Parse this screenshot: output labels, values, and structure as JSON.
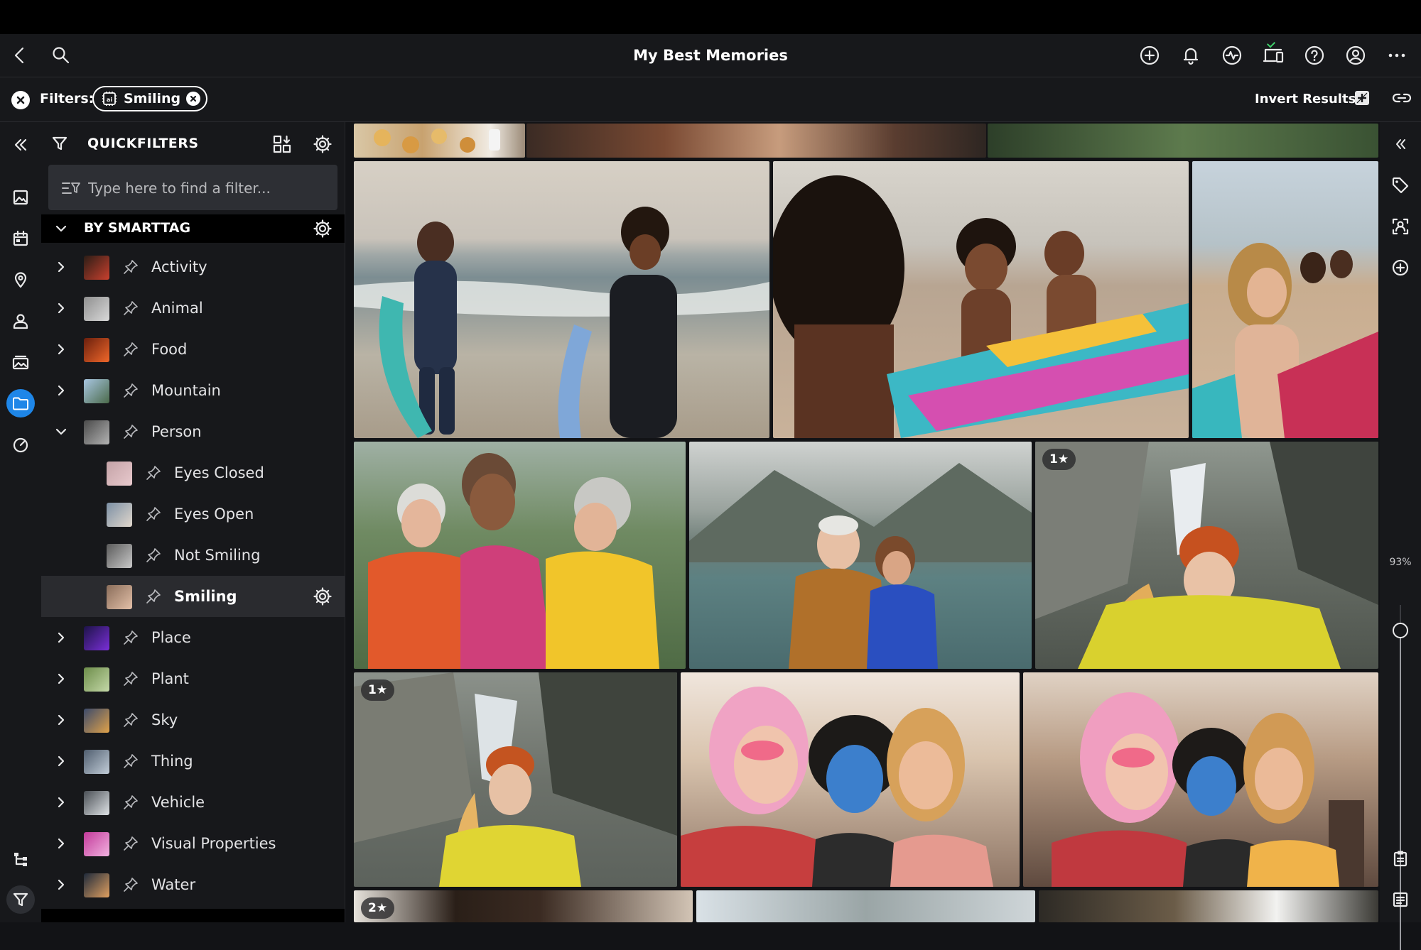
{
  "window": {
    "title": "My Best Memories"
  },
  "filterbar": {
    "label": "Filters:",
    "active_filter": "Smiling",
    "invert_label": "Invert Results"
  },
  "quickfilters": {
    "title": "QUICKFILTERS",
    "search_placeholder": "Type here to find a filter...",
    "section_title": "BY SMARTTAG",
    "tags": [
      {
        "label": "Activity",
        "level": 0,
        "expanded": false
      },
      {
        "label": "Animal",
        "level": 0,
        "expanded": false
      },
      {
        "label": "Food",
        "level": 0,
        "expanded": false
      },
      {
        "label": "Mountain",
        "level": 0,
        "expanded": false
      },
      {
        "label": "Person",
        "level": 0,
        "expanded": true
      },
      {
        "label": "Eyes Closed",
        "level": 1
      },
      {
        "label": "Eyes Open",
        "level": 1
      },
      {
        "label": "Not Smiling",
        "level": 1
      },
      {
        "label": "Smiling",
        "level": 1,
        "selected": true
      },
      {
        "label": "Place",
        "level": 0,
        "expanded": false
      },
      {
        "label": "Plant",
        "level": 0,
        "expanded": false
      },
      {
        "label": "Sky",
        "level": 0,
        "expanded": false
      },
      {
        "label": "Thing",
        "level": 0,
        "expanded": false
      },
      {
        "label": "Vehicle",
        "level": 0,
        "expanded": false
      },
      {
        "label": "Visual Properties",
        "level": 0,
        "expanded": false
      },
      {
        "label": "Water",
        "level": 0,
        "expanded": false
      }
    ]
  },
  "grid": {
    "ratings": {
      "glacier_hat": "1★",
      "glacier_woman": "1★",
      "bottom_left": "2★"
    }
  },
  "zoom": {
    "label": "93%",
    "level": 0.93
  },
  "icons": {
    "titlebar_left": [
      "back-icon",
      "search-icon"
    ],
    "titlebar_right": [
      "add-icon",
      "bell-icon",
      "activity-icon",
      "devices-icon",
      "help-icon",
      "account-icon",
      "more-icon"
    ],
    "left_rail": [
      "collapse-panel-icon",
      "photos-icon",
      "calendar-icon",
      "location-icon",
      "people-icon",
      "albums-icon",
      "folder-icon",
      "dashboard-icon",
      "hierarchy-icon",
      "filter-icon"
    ],
    "right_rail": [
      "expand-panel-icon",
      "tag-icon",
      "face-tag-icon",
      "add-circle-icon",
      "clipboard-icon",
      "details-icon"
    ]
  },
  "colors": {
    "accent": "#1e86e8",
    "background": "#121316",
    "panel": "#17181b"
  }
}
